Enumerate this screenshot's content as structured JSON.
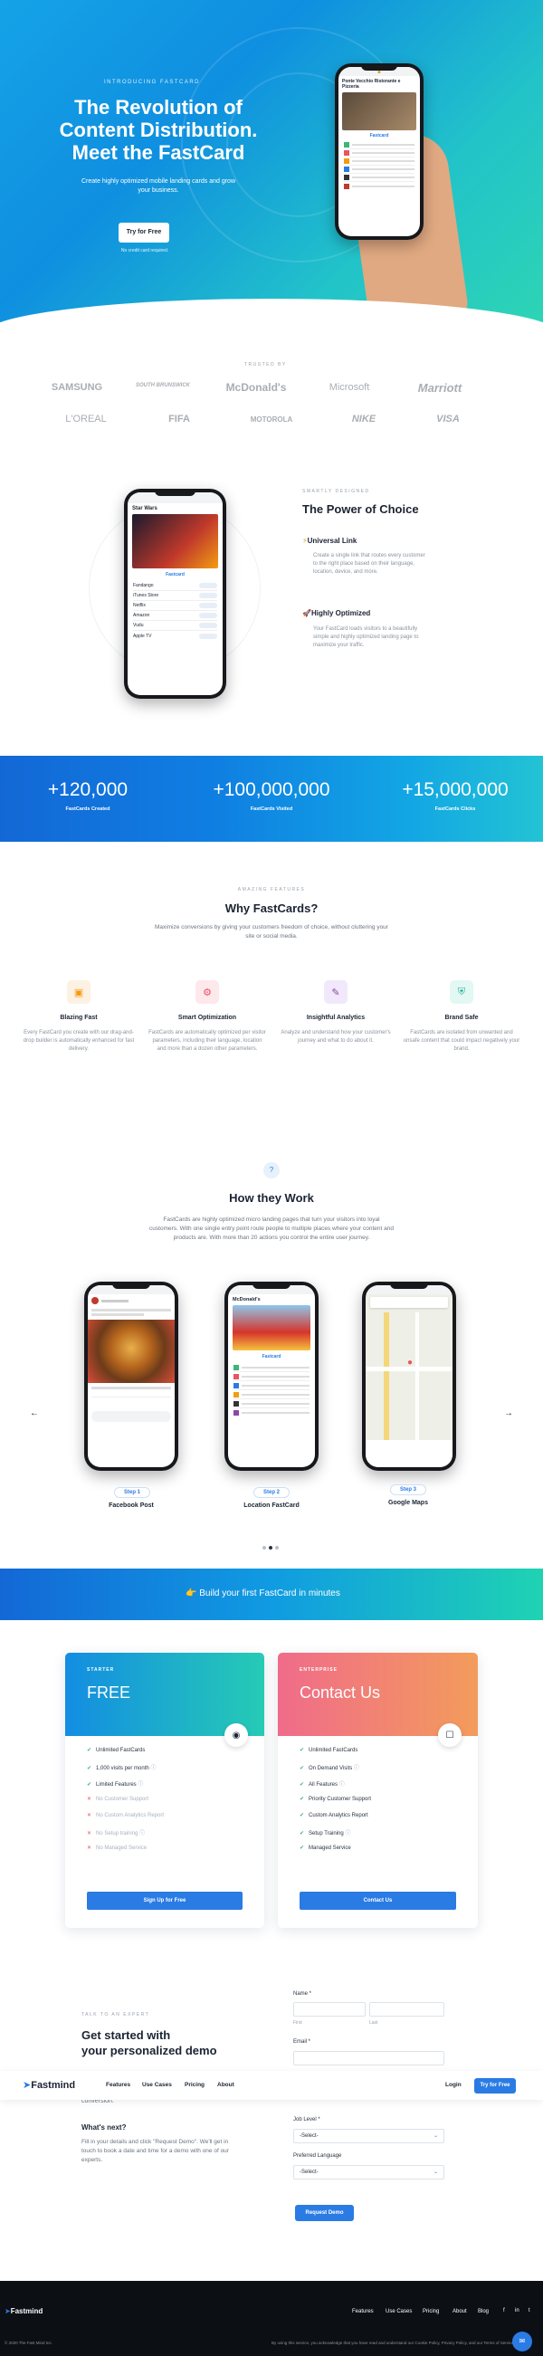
{
  "hero": {
    "eyebrow": "INTRODUCING FASTCARD",
    "title_line1": "The Revolution of",
    "title_line2": "Content Distribution.",
    "title_line3": "Meet the FastCard",
    "subtitle": "Create highly optimized mobile landing cards and grow your business.",
    "cta": "Try for Free",
    "cta_note": "No credit card required.",
    "phone_title": "Ponte Vecchio Ristorante e Pizzeria",
    "phone_brand": "Fastcard"
  },
  "trusted": {
    "label": "TRUSTED BY",
    "logos": [
      "SAMSUNG",
      "SOUTH BRUNSWICK",
      "McDonald's",
      "Microsoft",
      "Marriott",
      "L'OREAL",
      "FIFA",
      "MOTOROLA",
      "NIKE",
      "VISA"
    ]
  },
  "power": {
    "eyebrow": "SMARTLY DESIGNED",
    "title": "The Power of Choice",
    "f1_title": "Universal Link",
    "f1_text": "Create a single link that routes every customer to the right place based on their language, location, device, and more.",
    "f2_title": "Highly Optimized",
    "f2_text": "Your FastCard loads visitors to a beautifully simple and highly optimized landing page to maximize your traffic.",
    "phone_title": "Star Wars",
    "rows": [
      "Fandango",
      "iTunes Store",
      "Netflix",
      "Amazon",
      "Vudu",
      "Apple TV"
    ]
  },
  "stats": [
    {
      "value": "+120,000",
      "label": "FastCards Created"
    },
    {
      "value": "+100,000,000",
      "label": "FastCards Visited"
    },
    {
      "value": "+15,000,000",
      "label": "FastCards Clicks"
    }
  ],
  "why": {
    "eyebrow": "AMAZING FEATURES",
    "title": "Why FastCards?",
    "subtitle": "Maximize conversions by giving your customers freedom of choice, without cluttering your site or social media.",
    "cols": [
      {
        "title": "Blazing Fast",
        "text": "Every FastCard you create with our drag-and-drop builder is automatically enhanced for fast delivery."
      },
      {
        "title": "Smart Optimization",
        "text": "FastCards are automatically optimized per visitor parameters, including their language, location and more than a dozen other parameters."
      },
      {
        "title": "Insightful Analytics",
        "text": "Analyze and understand how your customer's journey and what to do about it."
      },
      {
        "title": "Brand Safe",
        "text": "FastCards are isolated from unwanted and unsafe content that could impact negatively your brand."
      }
    ]
  },
  "how": {
    "title": "How they Work",
    "subtitle": "FastCards are highly optimized micro landing pages that turn your visitors into loyal customers. With one single entry point route people to multiple places where your content and products are. With more than 20 actions you control the entire user journey.",
    "steps": [
      {
        "pill": "Step 1",
        "name": "Facebook Post"
      },
      {
        "pill": "Step 2",
        "name": "Location FastCard"
      },
      {
        "pill": "Step 3",
        "name": "Google Maps"
      }
    ],
    "mcd_title": "McDonald's",
    "prev": "←",
    "next": "→"
  },
  "cta_bar": {
    "text": "Build your first FastCard in minutes"
  },
  "pricing": {
    "starter": {
      "tag": "STARTER",
      "name": "FREE",
      "features": [
        {
          "text": "Unlimited FastCards",
          "on": true
        },
        {
          "text": "1,000 visits per month",
          "on": true
        },
        {
          "text": "Limited Features",
          "on": true
        },
        {
          "text": "No Customer Support",
          "on": false
        },
        {
          "text": "No Custom Analytics Report",
          "on": false
        },
        {
          "text": "No Setup training",
          "on": false
        },
        {
          "text": "No Managed Service",
          "on": false
        }
      ],
      "button": "Sign Up for Free"
    },
    "enterprise": {
      "tag": "ENTERPRISE",
      "name": "Contact Us",
      "features": [
        {
          "text": "Unlimited FastCards",
          "on": true
        },
        {
          "text": "On Demand Visits",
          "on": true
        },
        {
          "text": "All Features",
          "on": true
        },
        {
          "text": "Priority Customer Support",
          "on": true
        },
        {
          "text": "Custom Analytics Report",
          "on": true
        },
        {
          "text": "Setup Training",
          "on": true
        },
        {
          "text": "Managed Service",
          "on": true
        }
      ],
      "button": "Contact Us"
    }
  },
  "demo": {
    "eyebrow": "TALK TO AN EXPERT",
    "title_line1": "Get started with",
    "title_line2": "your personalized demo",
    "partial": "conversion.",
    "next_title": "What's next?",
    "next_text": "Fill in your details and click \"Request Demo\". We'll get in touch to book a date and time for a demo with one of our experts.",
    "name_label": "Name *",
    "first": "First",
    "last": "Last",
    "email_label": "Email *",
    "job_label": "Job Level *",
    "job_value": "-Select-",
    "lang_label": "Preferred Language",
    "lang_value": "-Select-",
    "submit": "Request Demo"
  },
  "navbar": {
    "brand": "Fastmind",
    "links": [
      "Features",
      "Use Cases",
      "Pricing",
      "About"
    ],
    "login": "Login",
    "cta": "Try for Free"
  },
  "footer": {
    "brand": "Fastmind",
    "links": [
      "Features",
      "Use Cases",
      "Pricing",
      "About",
      "Blog"
    ],
    "copyright": "© 2020 The Fast Mind Inc.",
    "legal": "By using this service, you acknowledge that you have read and understand our Cookie Policy, Privacy Policy, and our Terms of Service."
  }
}
